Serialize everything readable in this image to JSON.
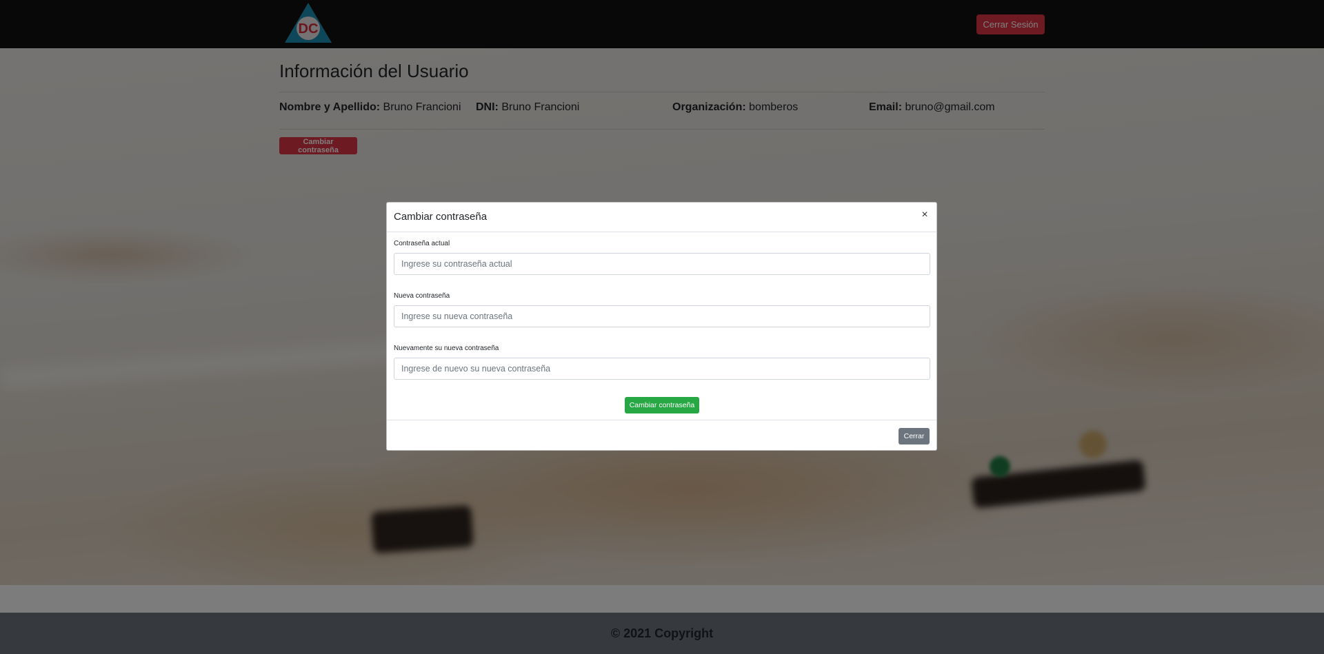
{
  "navbar": {
    "logo_text": "DC",
    "logout_label": "Cerrar Sesión"
  },
  "user_info": {
    "title": "Información del Usuario",
    "fields": [
      {
        "label": "Nombre y Apellido:",
        "value": "Bruno Francioni"
      },
      {
        "label": "DNI:",
        "value": "Bruno Francioni"
      },
      {
        "label": "Organización:",
        "value": "bomberos"
      },
      {
        "label": "Email:",
        "value": "bruno@gmail.com"
      }
    ],
    "change_password_label": "Cambiar contraseña"
  },
  "modal": {
    "title": "Cambiar contraseña",
    "close_icon": "×",
    "fields": [
      {
        "label": "Contraseña actual",
        "placeholder": "Ingrese su contraseña actual"
      },
      {
        "label": "Nueva contraseña",
        "placeholder": "Ingrese su nueva contraseña"
      },
      {
        "label": "Nuevamente su nueva contraseña",
        "placeholder": "Ingrese de nuevo su nueva contraseña"
      }
    ],
    "submit_label": "Cambiar contraseña",
    "close_label": "Cerrar"
  },
  "footer": {
    "copyright": "© 2021 Copyright"
  },
  "colors": {
    "navbar_bg": "#111111",
    "danger": "#dc3545",
    "success": "#28a745",
    "secondary": "#6c757d",
    "logo_triangle": "#1e8fb4",
    "logo_circle": "#e8e4e4",
    "logo_text": "#d62d3b"
  },
  "icons": {
    "logo": "dc-triangle-logo",
    "close": "close-icon"
  }
}
